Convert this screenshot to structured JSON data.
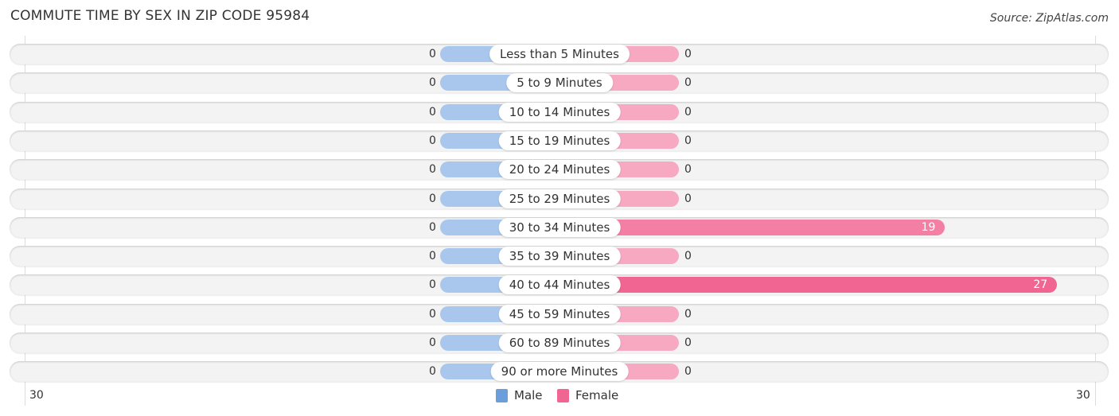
{
  "title": "COMMUTE TIME BY SEX IN ZIP CODE 95984",
  "source": "Source: ZipAtlas.com",
  "colors": {
    "male": "#a9c7ec",
    "female_light": "#f7a9c1",
    "female_mid": "#f47fa4",
    "female_strong": "#f06591",
    "legend_male": "#6a9fdb",
    "legend_female": "#f06591"
  },
  "legend": {
    "male": "Male",
    "female": "Female"
  },
  "axis": {
    "left_tick": "30",
    "right_tick": "30"
  },
  "chart_data": {
    "type": "bar",
    "orientation": "horizontal-diverging",
    "title": "COMMUTE TIME BY SEX IN ZIP CODE 95984",
    "categories": [
      "Less than 5 Minutes",
      "5 to 9 Minutes",
      "10 to 14 Minutes",
      "15 to 19 Minutes",
      "20 to 24 Minutes",
      "25 to 29 Minutes",
      "30 to 34 Minutes",
      "35 to 39 Minutes",
      "40 to 44 Minutes",
      "45 to 59 Minutes",
      "60 to 89 Minutes",
      "90 or more Minutes"
    ],
    "series": [
      {
        "name": "Male",
        "values": [
          0,
          0,
          0,
          0,
          0,
          0,
          0,
          0,
          0,
          0,
          0,
          0
        ]
      },
      {
        "name": "Female",
        "values": [
          0,
          0,
          0,
          0,
          0,
          0,
          19,
          0,
          27,
          0,
          0,
          0
        ]
      }
    ],
    "xlim": [
      30,
      30
    ],
    "legend": "bottom-center"
  }
}
